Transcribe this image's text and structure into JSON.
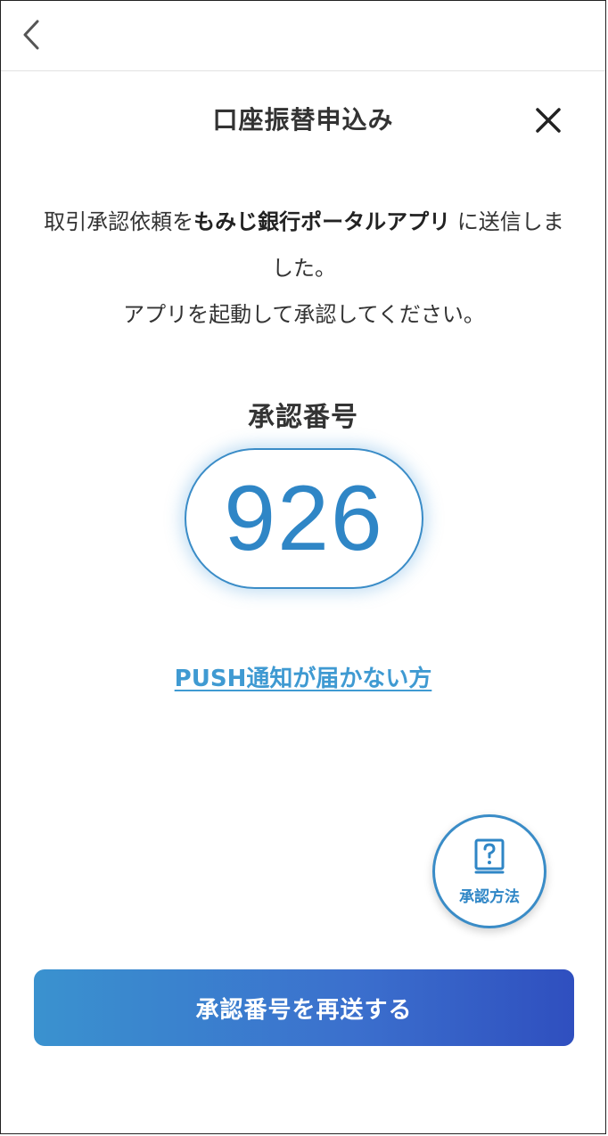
{
  "header": {
    "title": "口座振替申込み"
  },
  "message": {
    "line1_prefix": "取引承認依頼を",
    "app_name": "もみじ銀行ポータルアプリ",
    "line1_suffix": "に送信しました。",
    "line2": "アプリを起動して承認してください。"
  },
  "approval": {
    "label": "承認番号",
    "code": "926"
  },
  "links": {
    "push_not_received": "PUSH通知が届かない方"
  },
  "help": {
    "label": "承認方法",
    "icon": "question-book-icon"
  },
  "actions": {
    "resend_label": "承認番号を再送する"
  },
  "icons": {
    "back": "chevron-left-icon",
    "close": "close-icon"
  },
  "colors": {
    "accent": "#2f86c6",
    "link": "#3f9ad2",
    "button_start": "#3a92cf",
    "button_end": "#2f4fbf"
  }
}
